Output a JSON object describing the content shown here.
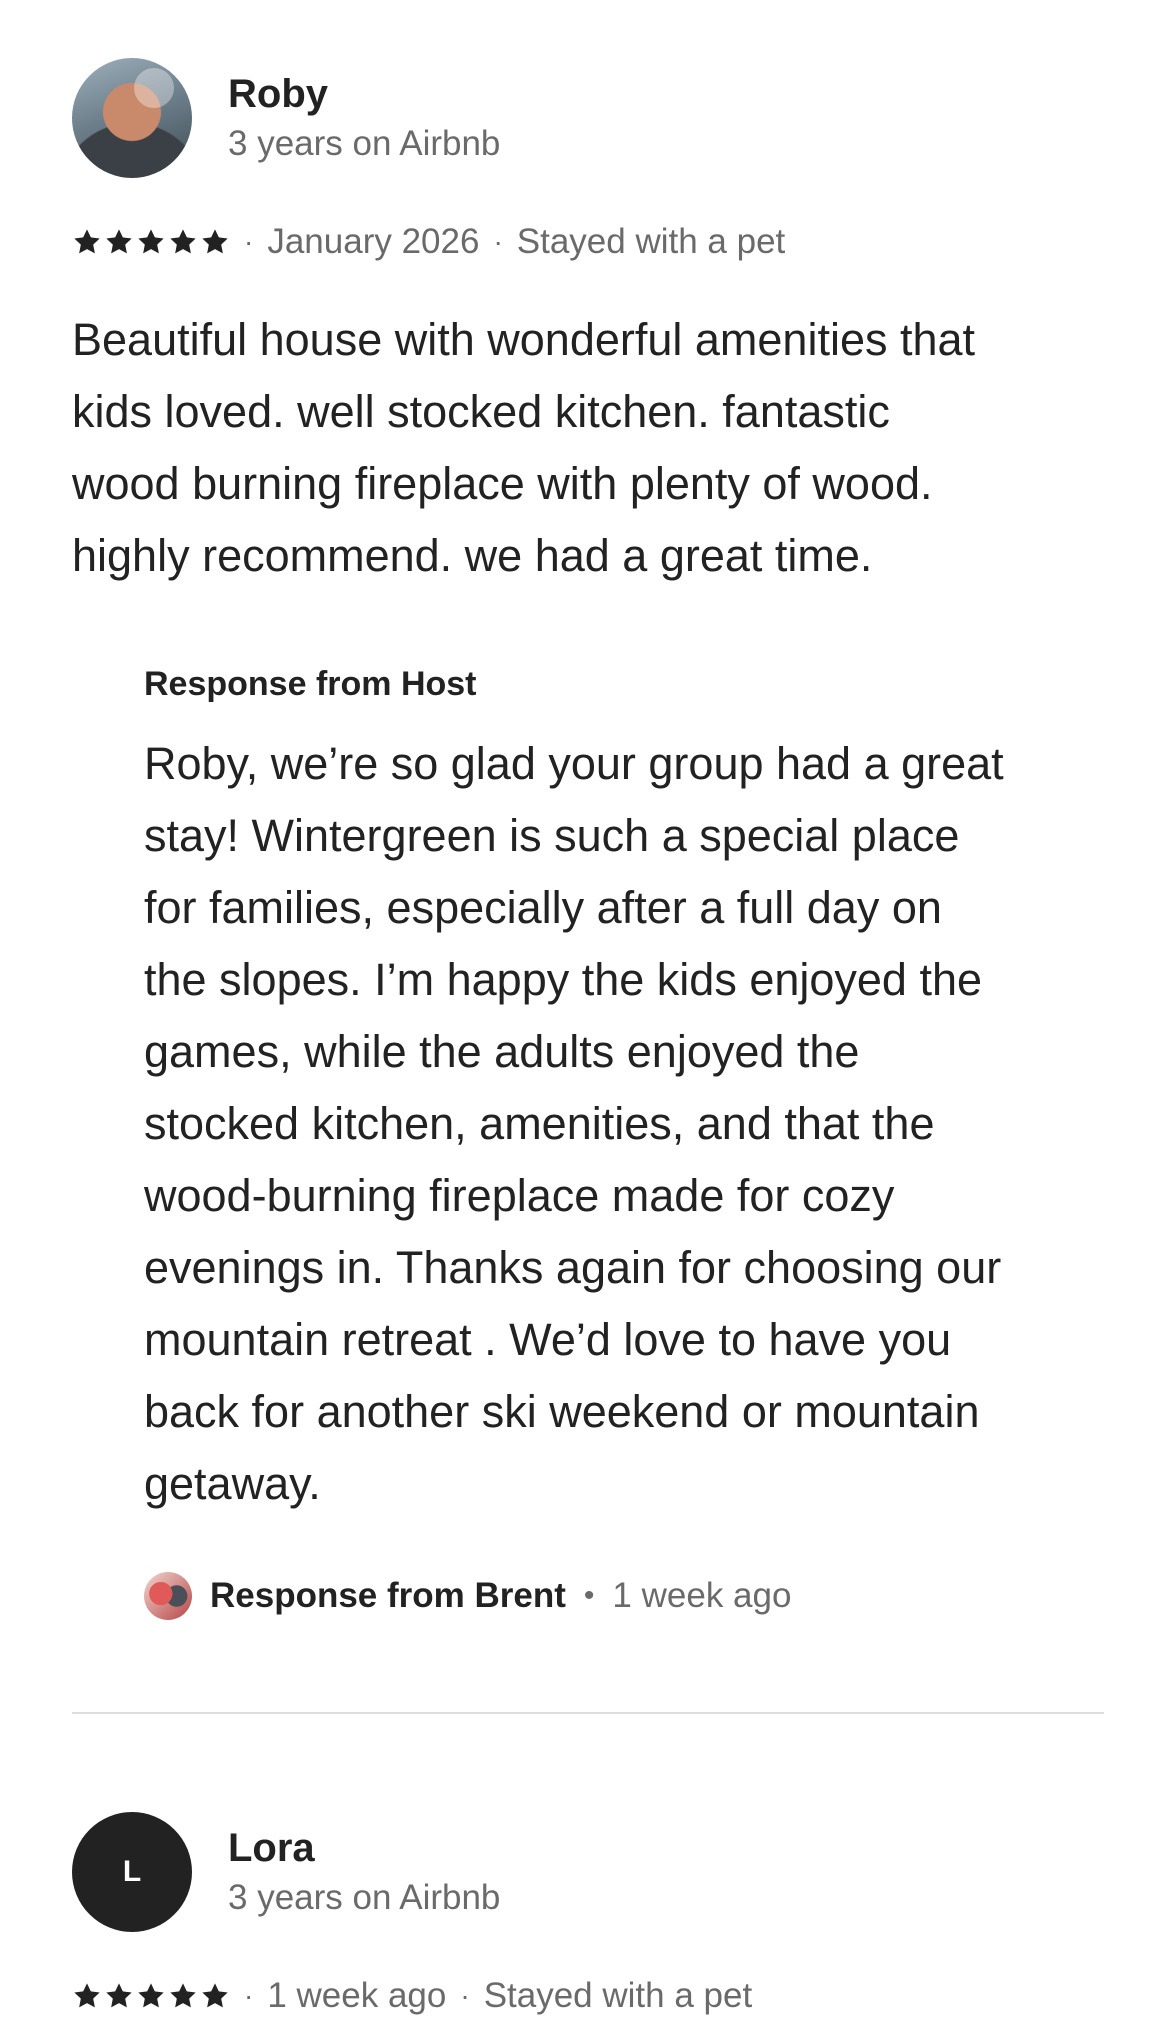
{
  "reviews": [
    {
      "name": "Roby",
      "tenure": "3 years on Airbnb",
      "stars": 5,
      "date": "January 2026",
      "trip_note": "Stayed with a pet",
      "text": "Beautiful house with wonderful amenities that\nkids loved.  well stocked kitchen. fantastic\nwood burning fireplace with plenty of wood.\nhighly recommend.  we had a great time.",
      "host_response": {
        "title": "Response from Host",
        "text": "Roby, we’re so glad your group had a great\nstay! Wintergreen is such a special place\nfor families, especially after a full day on\nthe slopes. I’m happy the kids enjoyed the\ngames, while the adults enjoyed the\nstocked kitchen, amenities, and that the\nwood-burning fireplace made for cozy\nevenings in. Thanks again for choosing our\nmountain retreat . We’d love to have you\nback for another ski weekend or mountain\ngetaway.",
        "byline": "Response from Brent",
        "time": "1 week ago"
      }
    },
    {
      "name": "Lora",
      "initial": "L",
      "tenure": "3 years on Airbnb",
      "stars": 5,
      "date": "1 week ago",
      "trip_note": "Stayed with a pet"
    }
  ],
  "separator_dot": "·",
  "byline_dot": "•",
  "colors": {
    "text_primary": "#222222",
    "text_secondary": "#6a6a6a",
    "divider": "#dddddd",
    "star": "#222222"
  },
  "icons": {
    "star": "star-icon"
  }
}
